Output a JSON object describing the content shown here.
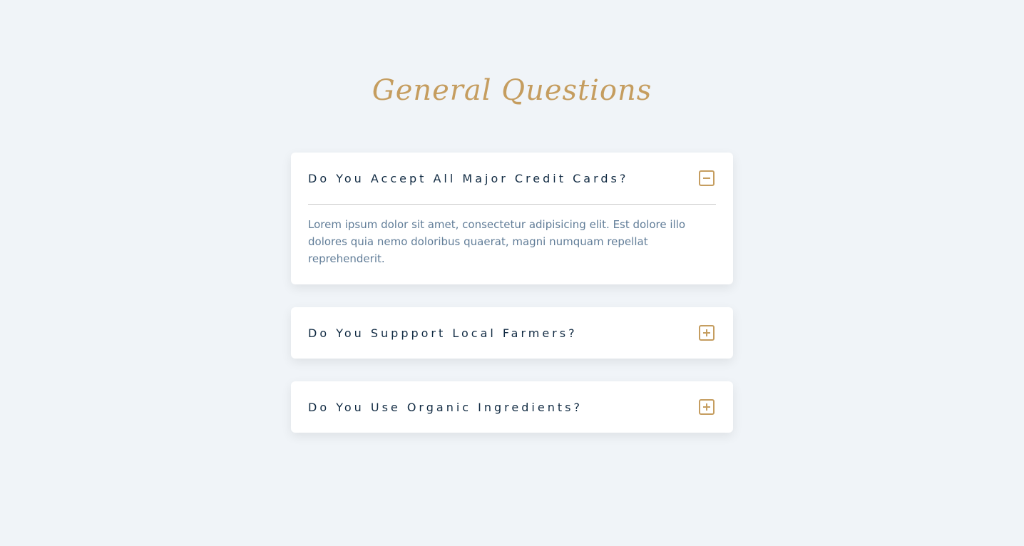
{
  "page": {
    "title": "General Questions"
  },
  "colors": {
    "background": "#f0f4f8",
    "accent": "#c59d5f",
    "question_text": "#102a42",
    "answer_text": "#617d98"
  },
  "faq": {
    "items": [
      {
        "question": "Do You Accept All Major Credit Cards?",
        "expanded": true,
        "toggle_icon": "minus-square-icon",
        "answer": "Lorem ipsum dolor sit amet, consectetur adipisicing elit. Est dolore illo dolores quia nemo doloribus quaerat, magni numquam repellat reprehenderit."
      },
      {
        "question": "Do You Suppport Local Farmers?",
        "expanded": false,
        "toggle_icon": "plus-square-icon"
      },
      {
        "question": "Do You Use Organic Ingredients?",
        "expanded": false,
        "toggle_icon": "plus-square-icon"
      }
    ]
  }
}
